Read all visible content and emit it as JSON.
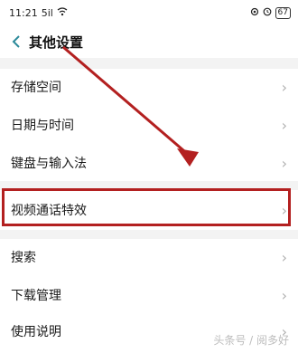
{
  "status": {
    "time": "11:21",
    "signal": "5il",
    "wifi": "wifi-icon",
    "right_icons": [
      "settings-icon",
      "alarm-icon"
    ],
    "battery": "67"
  },
  "header": {
    "back_icon": "chevron-left-icon",
    "title": "其他设置"
  },
  "items": [
    {
      "label": "存储空间"
    },
    {
      "label": "日期与时间"
    },
    {
      "label": "键盘与输入法"
    },
    {
      "label": "视频通话特效"
    },
    {
      "label": "搜索"
    },
    {
      "label": "下载管理"
    },
    {
      "label": "使用说明"
    }
  ],
  "watermark": "头条号 / 阅多好",
  "accent": "#b32020"
}
